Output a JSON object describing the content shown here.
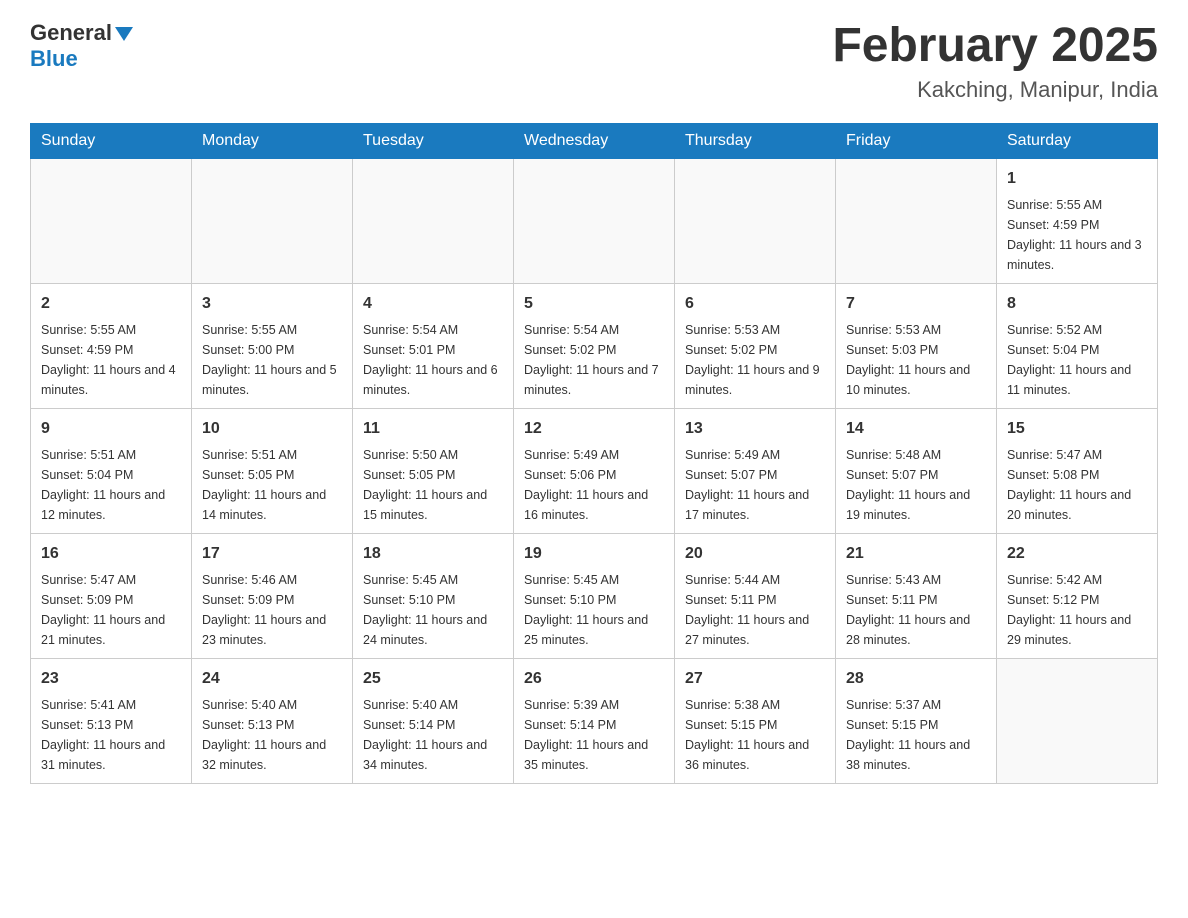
{
  "header": {
    "logo_general": "General",
    "logo_blue": "Blue",
    "title": "February 2025",
    "subtitle": "Kakching, Manipur, India"
  },
  "days_of_week": [
    "Sunday",
    "Monday",
    "Tuesday",
    "Wednesday",
    "Thursday",
    "Friday",
    "Saturday"
  ],
  "weeks": [
    [
      {
        "day": "",
        "info": ""
      },
      {
        "day": "",
        "info": ""
      },
      {
        "day": "",
        "info": ""
      },
      {
        "day": "",
        "info": ""
      },
      {
        "day": "",
        "info": ""
      },
      {
        "day": "",
        "info": ""
      },
      {
        "day": "1",
        "info": "Sunrise: 5:55 AM\nSunset: 4:59 PM\nDaylight: 11 hours and 3 minutes."
      }
    ],
    [
      {
        "day": "2",
        "info": "Sunrise: 5:55 AM\nSunset: 4:59 PM\nDaylight: 11 hours and 4 minutes."
      },
      {
        "day": "3",
        "info": "Sunrise: 5:55 AM\nSunset: 5:00 PM\nDaylight: 11 hours and 5 minutes."
      },
      {
        "day": "4",
        "info": "Sunrise: 5:54 AM\nSunset: 5:01 PM\nDaylight: 11 hours and 6 minutes."
      },
      {
        "day": "5",
        "info": "Sunrise: 5:54 AM\nSunset: 5:02 PM\nDaylight: 11 hours and 7 minutes."
      },
      {
        "day": "6",
        "info": "Sunrise: 5:53 AM\nSunset: 5:02 PM\nDaylight: 11 hours and 9 minutes."
      },
      {
        "day": "7",
        "info": "Sunrise: 5:53 AM\nSunset: 5:03 PM\nDaylight: 11 hours and 10 minutes."
      },
      {
        "day": "8",
        "info": "Sunrise: 5:52 AM\nSunset: 5:04 PM\nDaylight: 11 hours and 11 minutes."
      }
    ],
    [
      {
        "day": "9",
        "info": "Sunrise: 5:51 AM\nSunset: 5:04 PM\nDaylight: 11 hours and 12 minutes."
      },
      {
        "day": "10",
        "info": "Sunrise: 5:51 AM\nSunset: 5:05 PM\nDaylight: 11 hours and 14 minutes."
      },
      {
        "day": "11",
        "info": "Sunrise: 5:50 AM\nSunset: 5:05 PM\nDaylight: 11 hours and 15 minutes."
      },
      {
        "day": "12",
        "info": "Sunrise: 5:49 AM\nSunset: 5:06 PM\nDaylight: 11 hours and 16 minutes."
      },
      {
        "day": "13",
        "info": "Sunrise: 5:49 AM\nSunset: 5:07 PM\nDaylight: 11 hours and 17 minutes."
      },
      {
        "day": "14",
        "info": "Sunrise: 5:48 AM\nSunset: 5:07 PM\nDaylight: 11 hours and 19 minutes."
      },
      {
        "day": "15",
        "info": "Sunrise: 5:47 AM\nSunset: 5:08 PM\nDaylight: 11 hours and 20 minutes."
      }
    ],
    [
      {
        "day": "16",
        "info": "Sunrise: 5:47 AM\nSunset: 5:09 PM\nDaylight: 11 hours and 21 minutes."
      },
      {
        "day": "17",
        "info": "Sunrise: 5:46 AM\nSunset: 5:09 PM\nDaylight: 11 hours and 23 minutes."
      },
      {
        "day": "18",
        "info": "Sunrise: 5:45 AM\nSunset: 5:10 PM\nDaylight: 11 hours and 24 minutes."
      },
      {
        "day": "19",
        "info": "Sunrise: 5:45 AM\nSunset: 5:10 PM\nDaylight: 11 hours and 25 minutes."
      },
      {
        "day": "20",
        "info": "Sunrise: 5:44 AM\nSunset: 5:11 PM\nDaylight: 11 hours and 27 minutes."
      },
      {
        "day": "21",
        "info": "Sunrise: 5:43 AM\nSunset: 5:11 PM\nDaylight: 11 hours and 28 minutes."
      },
      {
        "day": "22",
        "info": "Sunrise: 5:42 AM\nSunset: 5:12 PM\nDaylight: 11 hours and 29 minutes."
      }
    ],
    [
      {
        "day": "23",
        "info": "Sunrise: 5:41 AM\nSunset: 5:13 PM\nDaylight: 11 hours and 31 minutes."
      },
      {
        "day": "24",
        "info": "Sunrise: 5:40 AM\nSunset: 5:13 PM\nDaylight: 11 hours and 32 minutes."
      },
      {
        "day": "25",
        "info": "Sunrise: 5:40 AM\nSunset: 5:14 PM\nDaylight: 11 hours and 34 minutes."
      },
      {
        "day": "26",
        "info": "Sunrise: 5:39 AM\nSunset: 5:14 PM\nDaylight: 11 hours and 35 minutes."
      },
      {
        "day": "27",
        "info": "Sunrise: 5:38 AM\nSunset: 5:15 PM\nDaylight: 11 hours and 36 minutes."
      },
      {
        "day": "28",
        "info": "Sunrise: 5:37 AM\nSunset: 5:15 PM\nDaylight: 11 hours and 38 minutes."
      },
      {
        "day": "",
        "info": ""
      }
    ]
  ]
}
